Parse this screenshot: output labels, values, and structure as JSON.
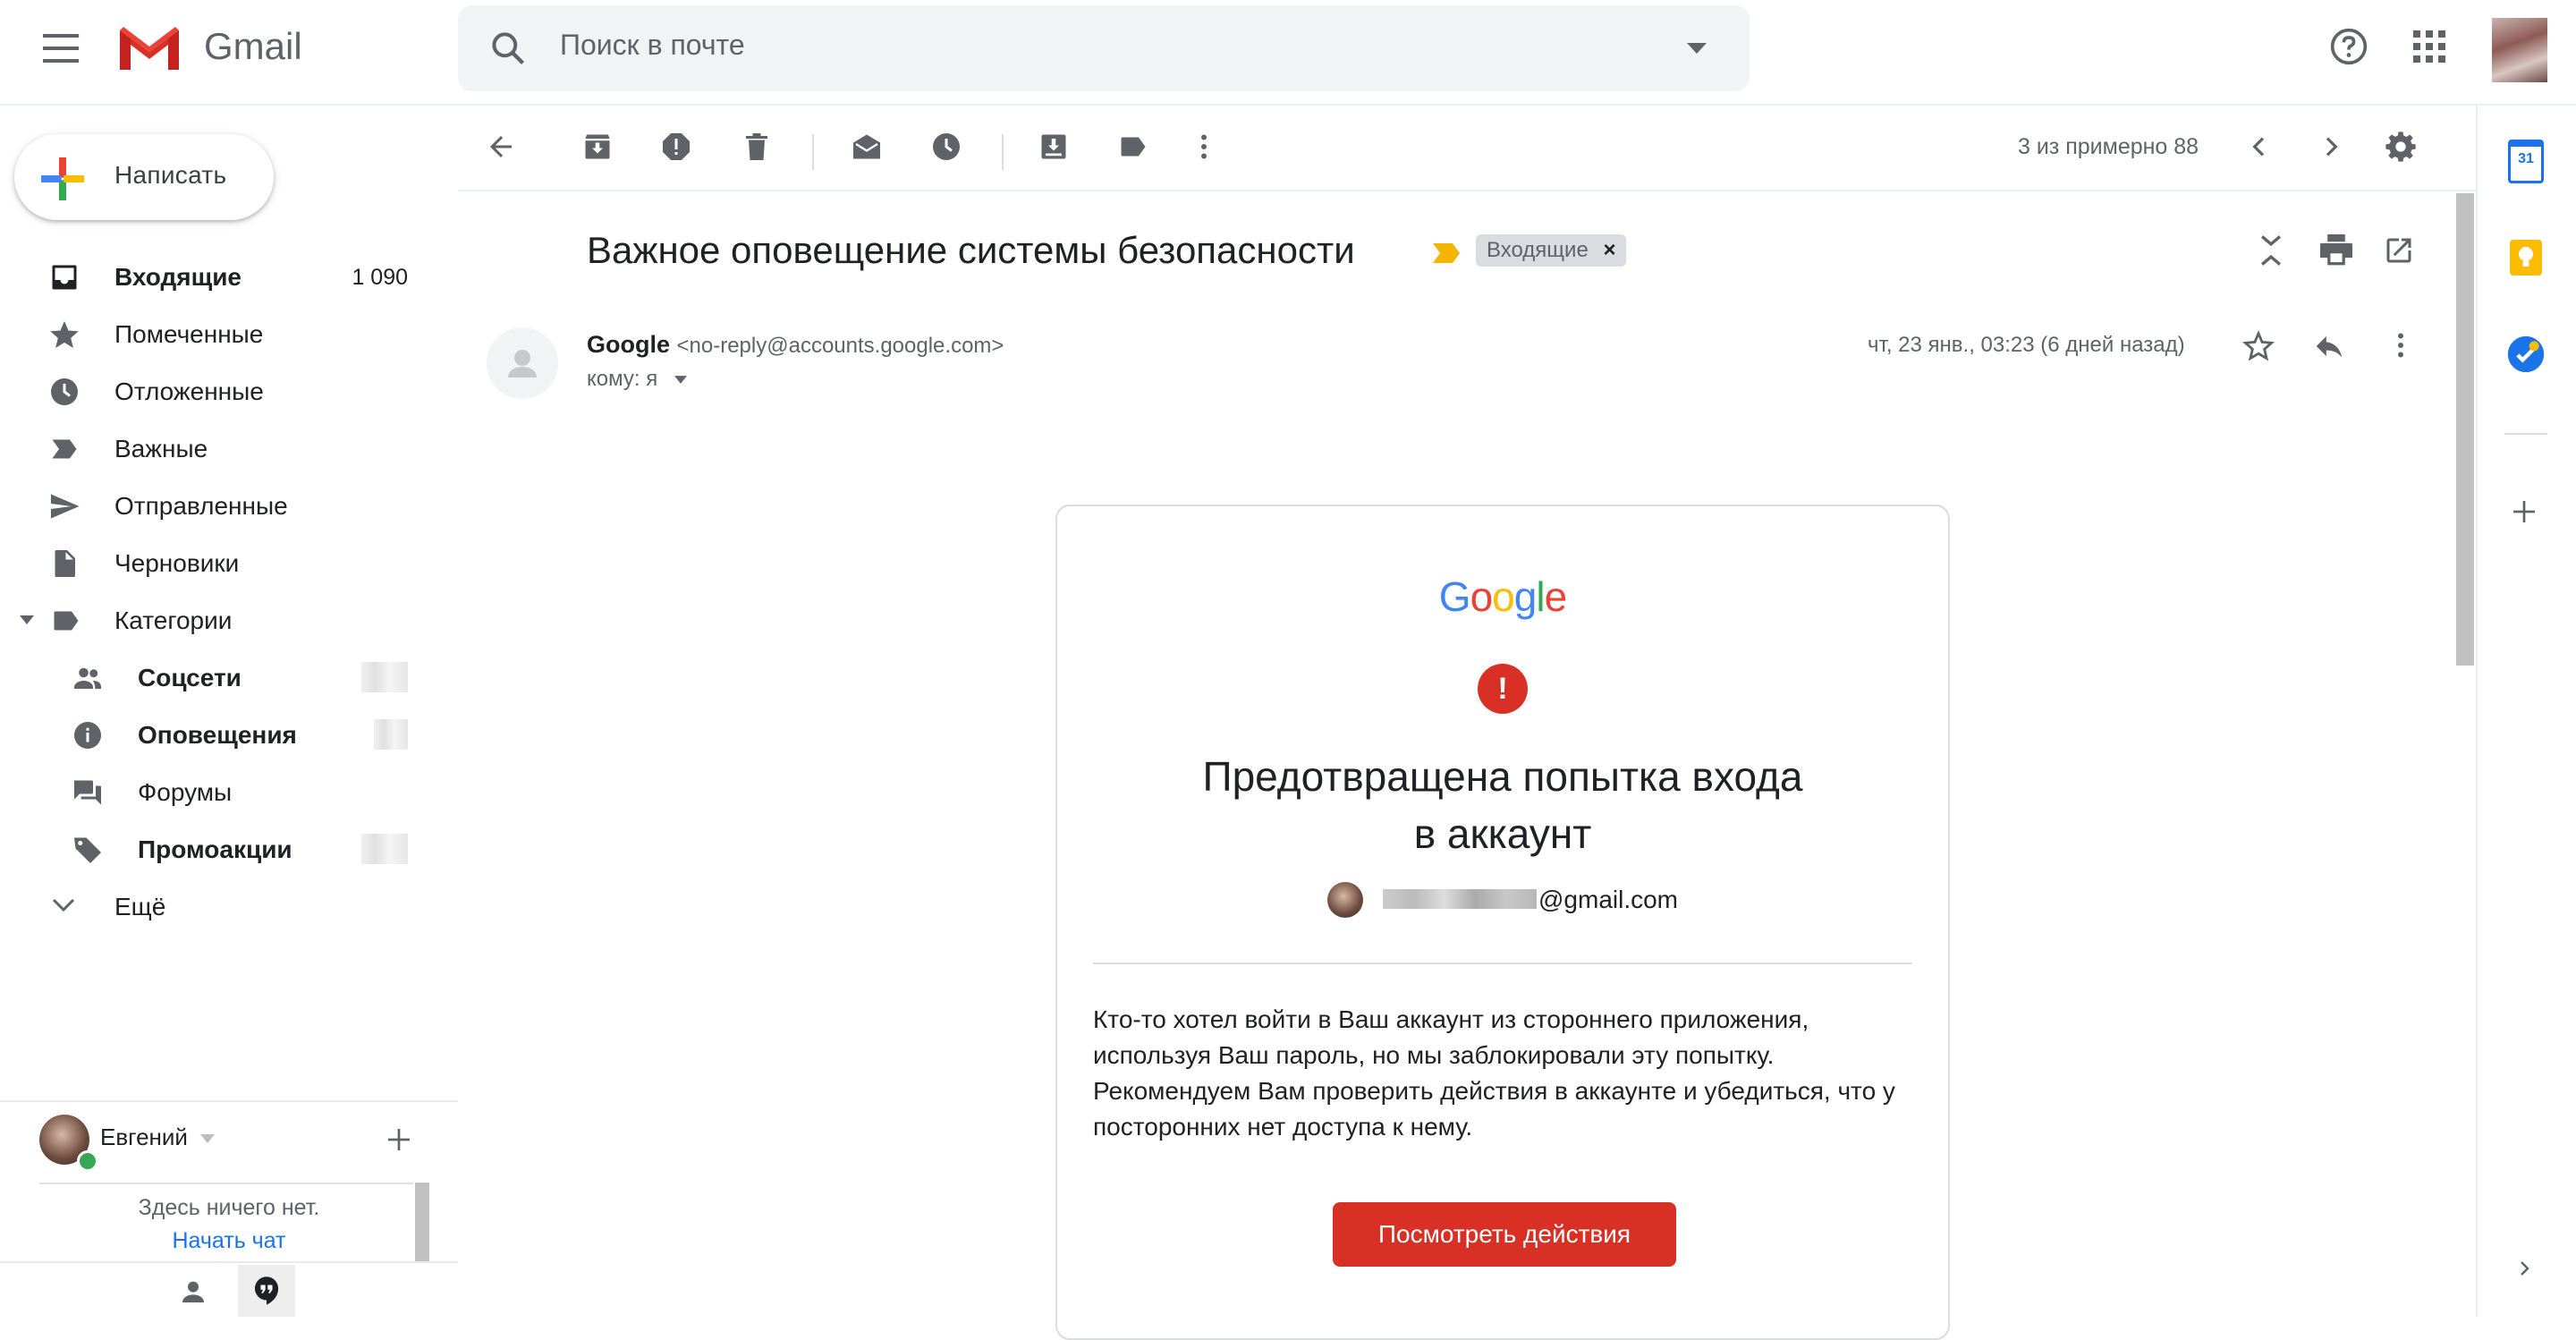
{
  "app": {
    "name": "Gmail"
  },
  "search": {
    "placeholder": "Поиск в почте"
  },
  "compose": {
    "label": "Написать"
  },
  "sidebar": {
    "items": [
      {
        "label": "Входящие",
        "count": "1 090",
        "icon": "inbox-icon"
      },
      {
        "label": "Помеченные",
        "icon": "star-icon"
      },
      {
        "label": "Отложенные",
        "icon": "clock-icon"
      },
      {
        "label": "Важные",
        "icon": "important-icon"
      },
      {
        "label": "Отправленные",
        "icon": "send-icon"
      },
      {
        "label": "Черновики",
        "icon": "draft-icon"
      },
      {
        "label": "Категории",
        "icon": "label-icon"
      },
      {
        "label": "Соцсети",
        "icon": "people-icon"
      },
      {
        "label": "Оповещения",
        "icon": "info-icon"
      },
      {
        "label": "Форумы",
        "icon": "forum-icon"
      },
      {
        "label": "Промоакции",
        "icon": "tag-icon"
      },
      {
        "label": "Ещё",
        "icon": "chevron-down-icon"
      }
    ]
  },
  "chat": {
    "user": "Евгений",
    "empty_text": "Здесь ничего нет.",
    "start_chat": "Начать чат"
  },
  "toolbar": {
    "pagination": "3 из примерно 88"
  },
  "email": {
    "subject": "Важное оповещение системы безопасности",
    "label_chip": "Входящие",
    "sender_name": "Google",
    "sender_email": "<no-reply@accounts.google.com>",
    "recipient": "кому: я",
    "date": "чт, 23 янв., 03:23 (6 дней назад)",
    "card": {
      "logo": "Google",
      "title_line1": "Предотвращена попытка входа",
      "title_line2": "в аккаунт",
      "account_email_suffix": "@gmail.com",
      "body": "Кто-то хотел войти в Ваш аккаунт из стороннего приложения, используя Ваш пароль, но мы заблокировали эту попытку. Рекомендуем Вам проверить действия в аккаунте и убедиться, что у посторонних нет доступа к нему.",
      "button": "Посмотреть действия"
    }
  },
  "side_apps": {
    "calendar_day": "31"
  },
  "colors": {
    "red": "#d93025",
    "blue": "#1a73e8",
    "yellow": "#fbbc04",
    "green": "#34a853",
    "chip_bg": "#dadce0"
  }
}
